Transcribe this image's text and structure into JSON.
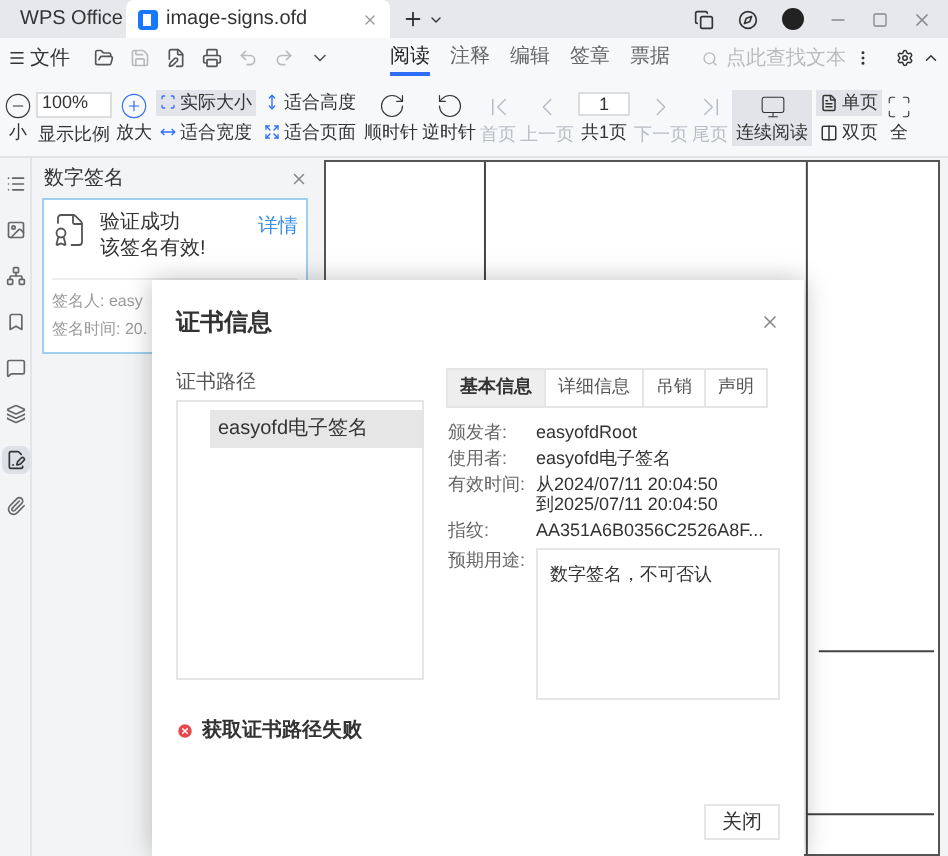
{
  "tabs": [
    {
      "label": "WPS Office",
      "selected": false,
      "kind": "home"
    },
    {
      "label": "image-signs.ofd",
      "selected": true,
      "kind": "doc"
    }
  ],
  "menu": {
    "file": "文件",
    "ribbon_tabs": [
      {
        "label": "阅读",
        "selected": true
      },
      {
        "label": "注释",
        "selected": false
      },
      {
        "label": "编辑",
        "selected": false
      },
      {
        "label": "签章",
        "selected": false
      },
      {
        "label": "票据",
        "selected": false
      }
    ],
    "search": {
      "placeholder": "点此查找文本"
    }
  },
  "toolbar": {
    "zoom_out": "小",
    "zoom": "100%",
    "zoom_label": "显示比例",
    "zoom_in": "放大",
    "fit": [
      {
        "label": "实际大小",
        "selected": true
      },
      {
        "label": "适合宽度",
        "selected": false
      },
      {
        "label": "适合高度",
        "selected": false
      },
      {
        "label": "适合页面",
        "selected": false
      }
    ],
    "rotate": [
      "顺时针",
      "逆时针"
    ],
    "nav_back": [
      {
        "label": "首页",
        "disabled": true
      },
      {
        "label": "上一页",
        "disabled": true
      }
    ],
    "page": "1",
    "page_total": "共1页",
    "nav_forward": [
      {
        "label": "下一页",
        "disabled": true
      },
      {
        "label": "尾页",
        "disabled": true
      }
    ],
    "continuous": {
      "label": "连续阅读",
      "selected": true
    },
    "layout": [
      {
        "label": "单页",
        "selected": true
      },
      {
        "label": "双页",
        "selected": false
      }
    ],
    "fullscreen": "全"
  },
  "rail": [
    {
      "kind": "outline",
      "selected": false
    },
    {
      "kind": "image",
      "selected": false
    },
    {
      "kind": "tree",
      "selected": false
    },
    {
      "kind": "bookmark",
      "selected": false
    },
    {
      "kind": "comment",
      "selected": false
    },
    {
      "kind": "layers",
      "selected": false
    },
    {
      "kind": "signature",
      "selected": true
    },
    {
      "kind": "attachment",
      "selected": false
    }
  ],
  "sidebar": {
    "title": "数字签名",
    "card": {
      "status": "验证成功",
      "message": "该签名有效!",
      "details": "详情",
      "signer": "签名人: easy",
      "time": "签名时间: 20."
    }
  },
  "dialog": {
    "title": "证书信息",
    "path_label": "证书路径",
    "path_items": [
      {
        "label": "easyofd电子签名",
        "selected": true
      }
    ],
    "tabs": [
      {
        "label": "基本信息",
        "selected": true
      },
      {
        "label": "详细信息",
        "selected": false
      },
      {
        "label": "吊销",
        "selected": false
      },
      {
        "label": "声明",
        "selected": false
      }
    ],
    "fields": [
      {
        "label": "颁发者:",
        "lines": [
          "easyofdRoot"
        ]
      },
      {
        "label": "使用者:",
        "lines": [
          "easyofd电子签名"
        ]
      },
      {
        "label": "有效时间:",
        "lines": [
          "从2024/07/11 20:04:50",
          "到2025/07/11 20:04:50"
        ]
      },
      {
        "label": "指纹:",
        "lines": [
          "AA351A6B0356C2526A8F..."
        ]
      }
    ],
    "purpose": {
      "label": "预期用途:",
      "value": "数字签名，不可否认"
    },
    "error": "获取证书路径失败",
    "close_button": "关闭"
  }
}
